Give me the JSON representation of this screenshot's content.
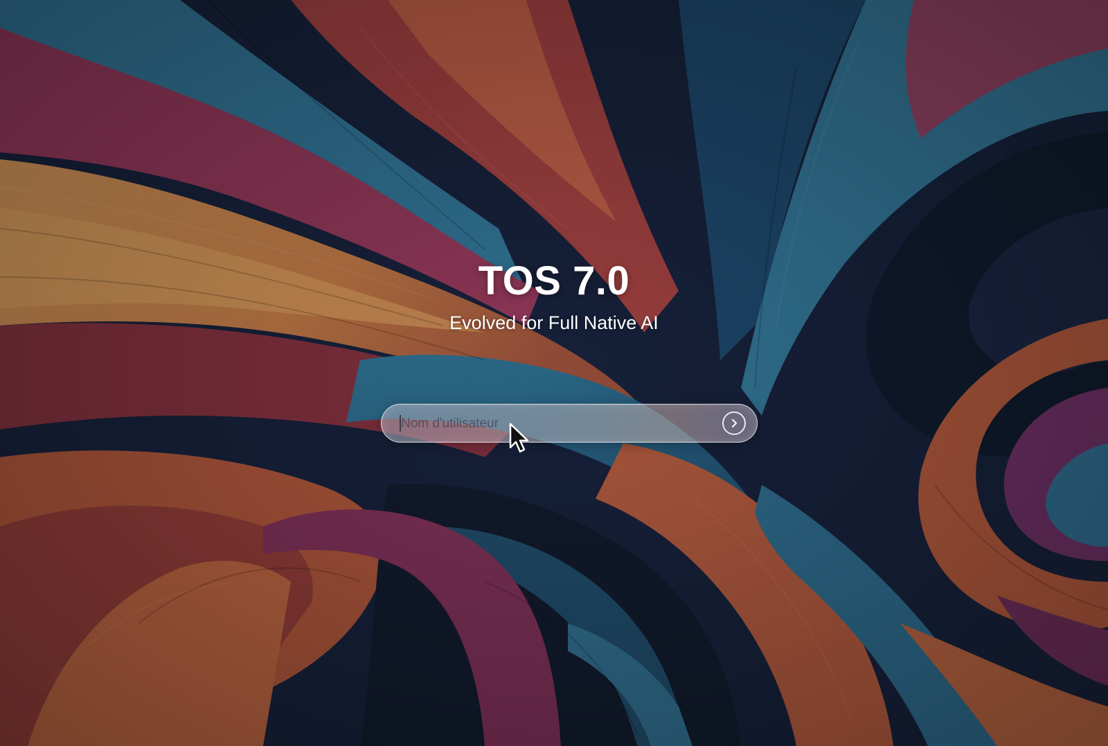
{
  "login": {
    "title": "TOS 7.0",
    "subtitle": "Evolved for Full Native AI",
    "username_placeholder": "Nom d'utilisateur",
    "username_value": "",
    "submit_icon": "arrow-right-circle-icon"
  },
  "cursor": {
    "icon": "mouse-pointer-icon"
  },
  "wallpaper": {
    "description_colors": [
      "#1a2a45",
      "#2f6d8c",
      "#8c3a5a",
      "#b0583c",
      "#c88a52",
      "#5a2f5e"
    ]
  }
}
